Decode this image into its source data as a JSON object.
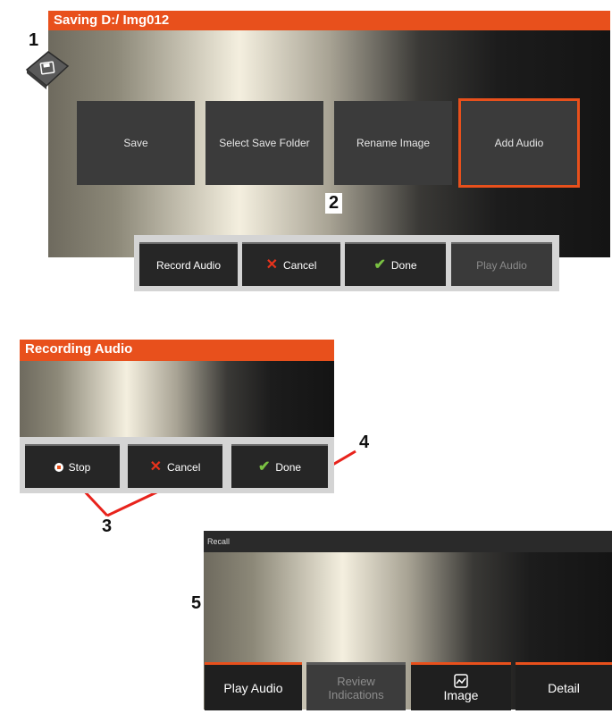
{
  "callouts": [
    "1",
    "2",
    "3",
    "4",
    "5"
  ],
  "panel1": {
    "title": "Saving D:/ Img012",
    "save_icon": "floppy-disk-icon",
    "menu": [
      {
        "label": "Save"
      },
      {
        "label": "Select Save Folder"
      },
      {
        "label": "Rename Image"
      },
      {
        "label": "Add Audio",
        "selected": true
      }
    ],
    "softkeys": {
      "record": "Record Audio",
      "cancel": "Cancel",
      "done": "Done",
      "play": "Play Audio"
    }
  },
  "panel2": {
    "title": "Recording Audio",
    "softkeys": {
      "stop": "Stop",
      "cancel": "Cancel",
      "done": "Done"
    }
  },
  "panel3": {
    "title": "Recall",
    "buttons": {
      "play_audio": "Play Audio",
      "review_indications": "Review Indications",
      "image": "Image",
      "detail": "Detail"
    }
  },
  "colors": {
    "accent": "#e8501c",
    "cancel_x": "#e8331c",
    "done_check": "#7ac142"
  }
}
